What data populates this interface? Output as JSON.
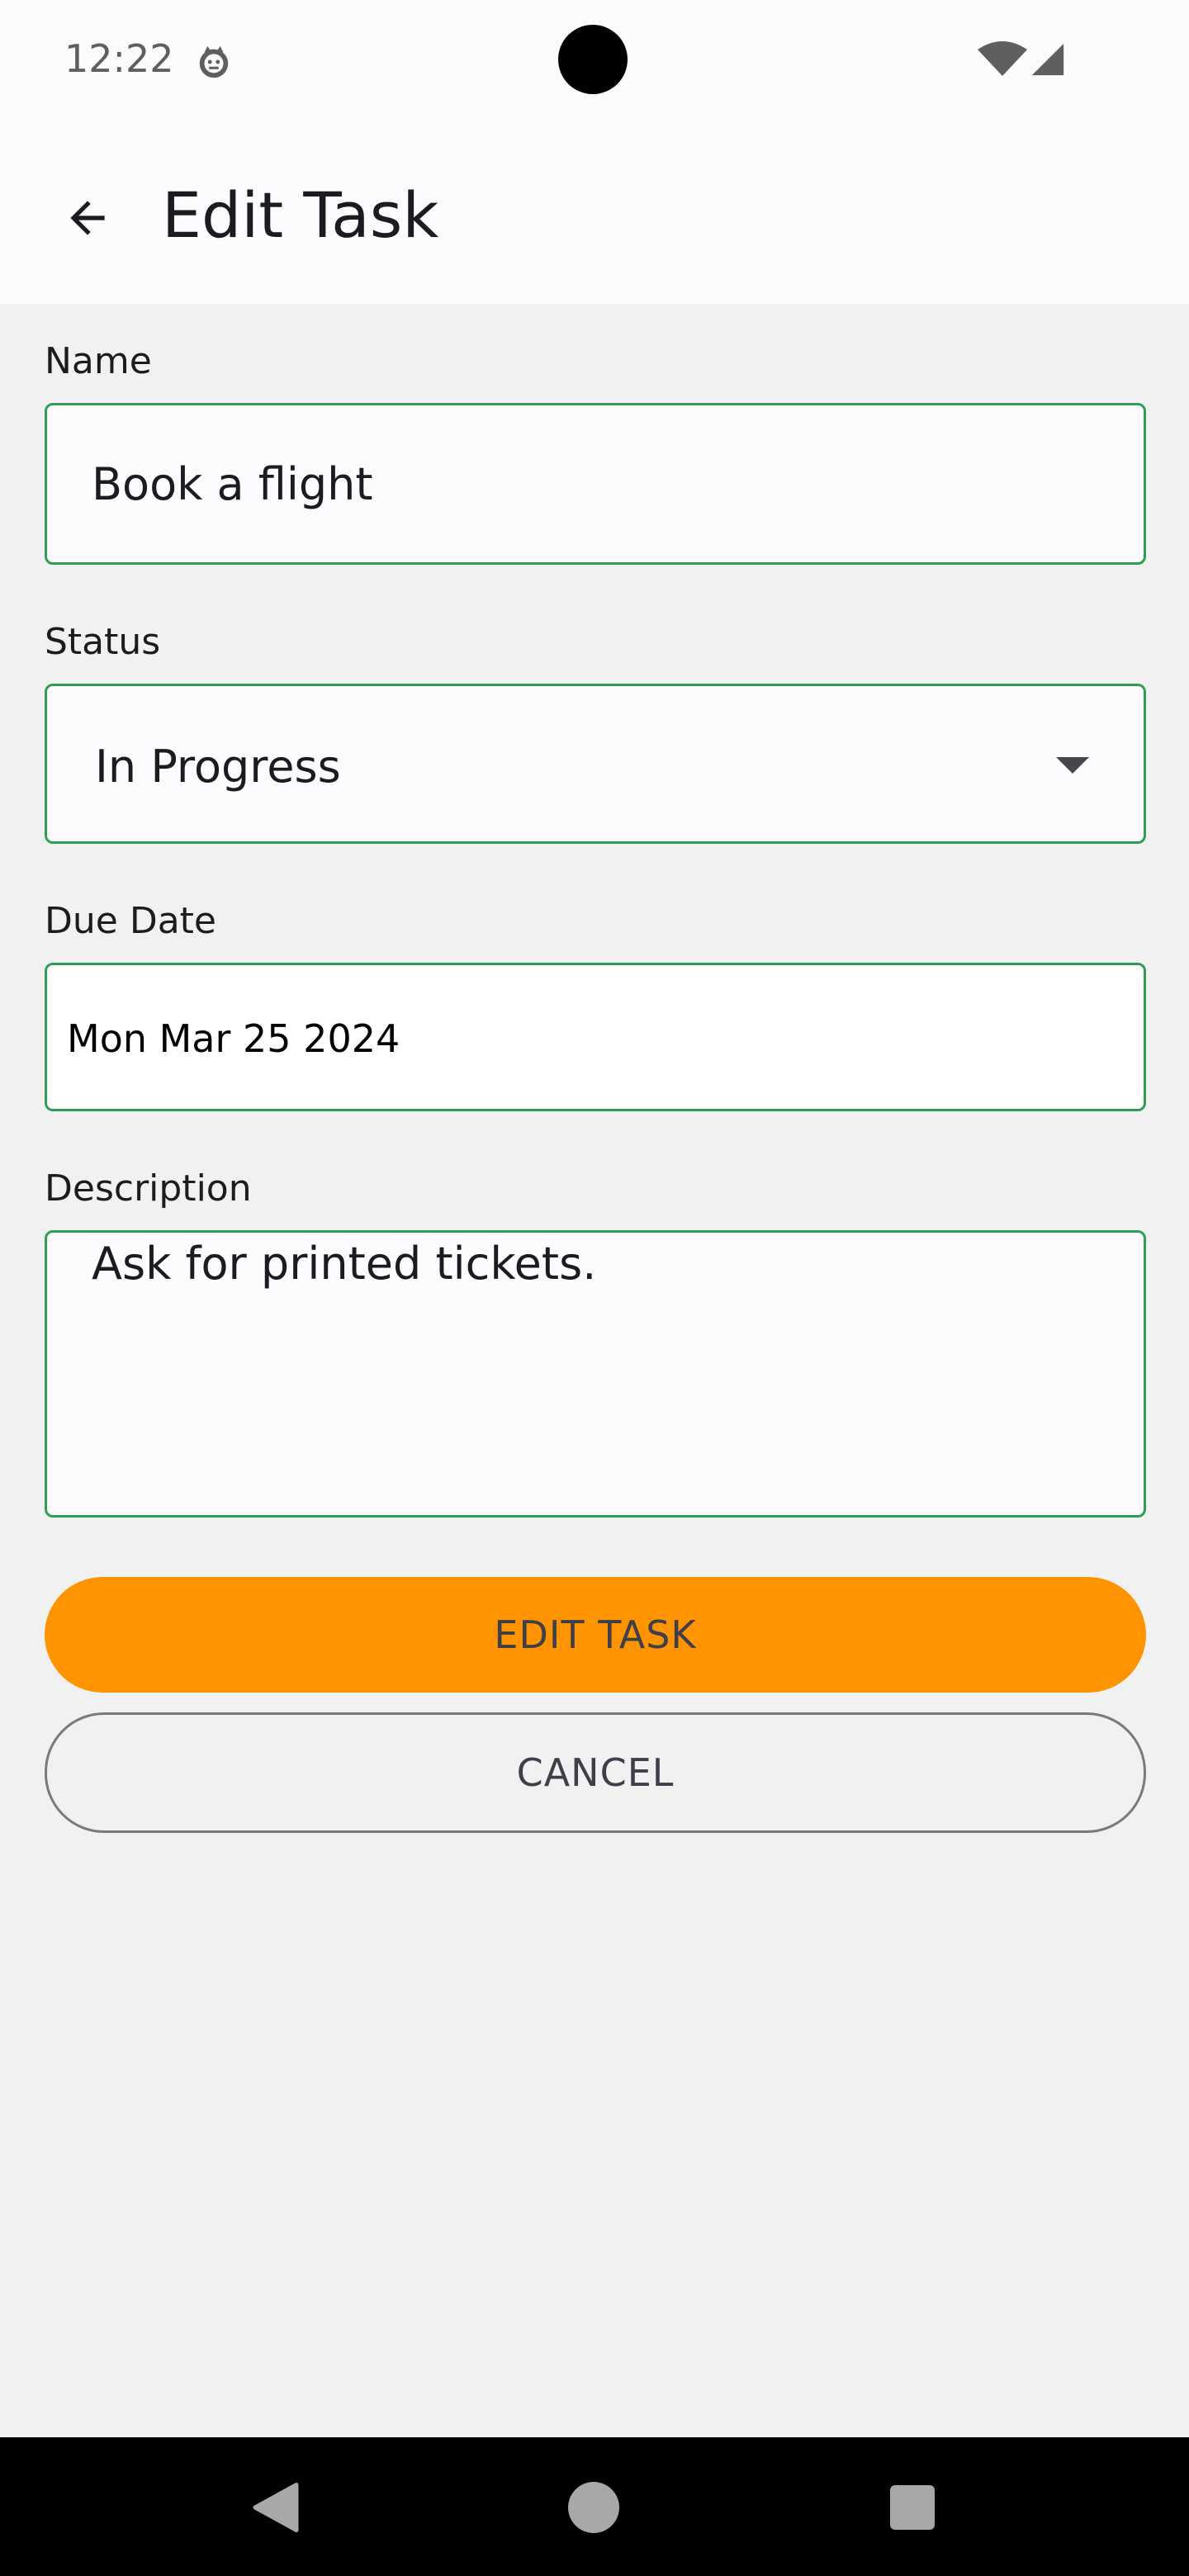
{
  "status_bar": {
    "time": "12:22",
    "icons": [
      "notification-icon",
      "wifi-icon",
      "cell-signal-icon"
    ]
  },
  "top_bar": {
    "back_icon": "arrow-left-icon",
    "title": "Edit Task"
  },
  "form": {
    "name": {
      "label": "Name",
      "value": "Book a flight"
    },
    "status": {
      "label": "Status",
      "selected": "In Progress",
      "icon": "chevron-down-icon"
    },
    "due_date": {
      "label": "Due Date",
      "value": "Mon Mar 25 2024"
    },
    "description": {
      "label": "Description",
      "value": "Ask for printed tickets."
    }
  },
  "actions": {
    "submit_label": "EDIT TASK",
    "cancel_label": "CANCEL"
  },
  "colors": {
    "accent_border": "#2e9e55",
    "primary_button": "#ff9300",
    "background": "#f1f1f1",
    "surface": "#fefbfe"
  },
  "nav_bar": {
    "icons": [
      "nav-back-icon",
      "nav-home-icon",
      "nav-recents-icon"
    ]
  }
}
